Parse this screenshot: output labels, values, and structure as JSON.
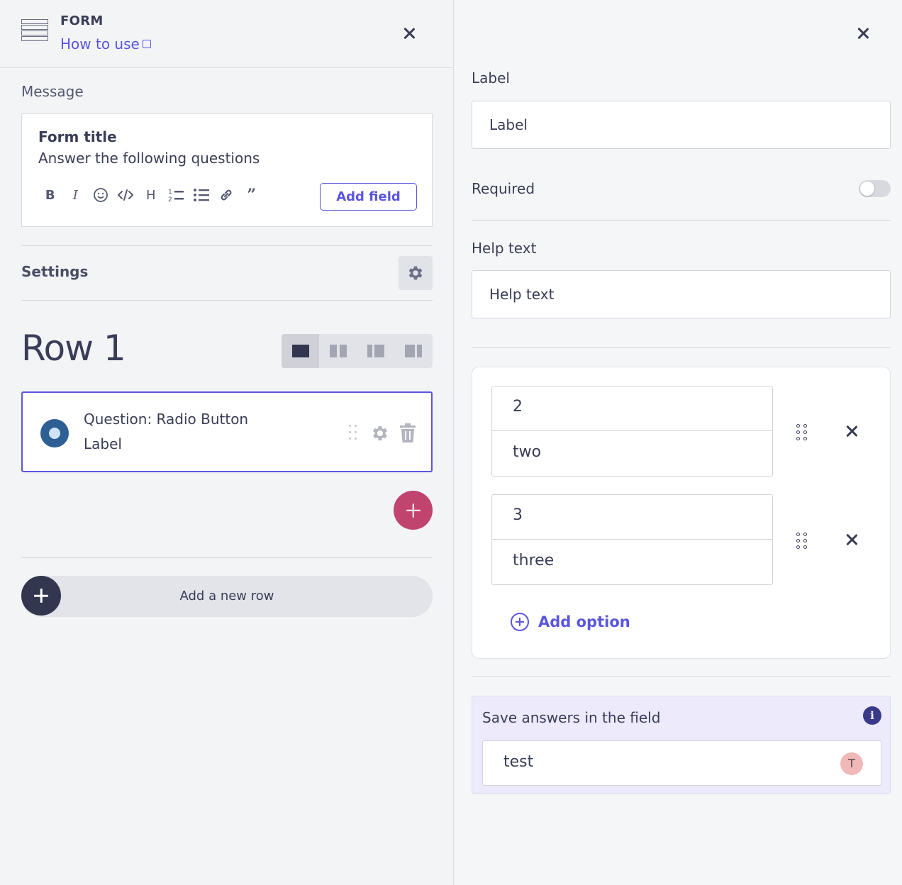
{
  "header": {
    "title": "FORM",
    "how_to_use": "How to use"
  },
  "message": {
    "section_label": "Message",
    "form_title": "Form title",
    "form_subtitle": "Answer the following questions",
    "toolbar": [
      "B",
      "I",
      "emoji",
      "code",
      "H",
      "ordered-list",
      "bullet-list",
      "link",
      "quote"
    ],
    "add_field_label": "Add field"
  },
  "settings": {
    "label": "Settings"
  },
  "row": {
    "title": "Row 1",
    "layout_options": [
      "one-column",
      "two-columns",
      "left-wide",
      "right-wide"
    ],
    "active_layout": "one-column",
    "question": {
      "type_text": "Question: Radio Button",
      "label": "Label"
    },
    "add_new_row": "Add a new row"
  },
  "panel": {
    "label_field": {
      "label": "Label",
      "value": "Label"
    },
    "required": {
      "label": "Required",
      "enabled": false
    },
    "help_text_field": {
      "label": "Help text",
      "value": "Help text"
    },
    "options": [
      {
        "value": "2",
        "label": "two"
      },
      {
        "value": "3",
        "label": "three"
      }
    ],
    "add_option_label": "Add option",
    "save_answers": {
      "label": "Save answers in the field",
      "value": "test",
      "avatar_initial": "T"
    }
  },
  "colors": {
    "accent": "#5a55e0",
    "add_button": "#c0446e",
    "radio": "#2d5f94",
    "dark": "#33364f"
  }
}
